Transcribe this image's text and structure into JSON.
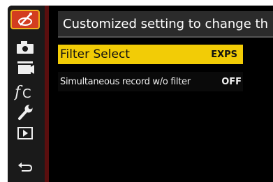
{
  "header": {
    "title": "Customized setting to change th"
  },
  "sidebar": {
    "items": [
      {
        "icon": "creative-filter-icon",
        "active": true
      },
      {
        "icon": "camera-icon",
        "active": false
      },
      {
        "icon": "video-camera-icon",
        "active": false
      },
      {
        "icon": "custom-fc-icon",
        "active": false
      },
      {
        "icon": "wrench-icon",
        "active": false
      },
      {
        "icon": "playback-icon",
        "active": false
      },
      {
        "icon": "return-icon",
        "active": false
      }
    ]
  },
  "menu": {
    "items": [
      {
        "label": "Filter Select",
        "value": "EXPS",
        "selected": true
      },
      {
        "label": "Simultaneous record w/o filter",
        "value": "OFF",
        "selected": false
      }
    ]
  },
  "colors": {
    "accent_red": "#d33d1f",
    "highlight_yellow": "#f2cc06",
    "active_border": "#f2b01c"
  }
}
